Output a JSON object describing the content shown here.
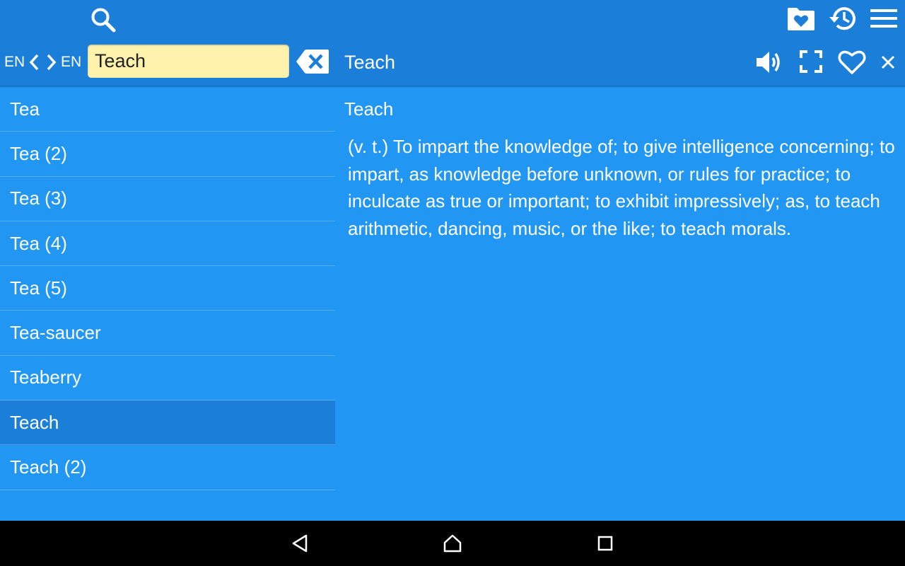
{
  "toolbar": {
    "source_lang": "EN",
    "target_lang": "EN",
    "search_value": "Teach",
    "search_placeholder": "",
    "current_word": "Teach"
  },
  "word_list": [
    {
      "label": "Tea",
      "selected": false
    },
    {
      "label": "Tea (2)",
      "selected": false
    },
    {
      "label": "Tea (3)",
      "selected": false
    },
    {
      "label": "Tea (4)",
      "selected": false
    },
    {
      "label": "Tea (5)",
      "selected": false
    },
    {
      "label": "Tea-saucer",
      "selected": false
    },
    {
      "label": "Teaberry",
      "selected": false
    },
    {
      "label": "Teach",
      "selected": true
    },
    {
      "label": "Teach (2)",
      "selected": false
    }
  ],
  "definition": {
    "title": "Teach",
    "text": "(v. t.) To impart the knowledge of; to give intelligence concerning; to impart, as knowledge before unknown, or rules for practice; to inculcate as true or important; to exhibit impressively; as, to teach arithmetic, dancing, music, or the like; to teach morals."
  },
  "colors": {
    "toolbar": "#1b7fd9",
    "background": "#2196f3",
    "selected_row": "#1b7fd9",
    "search_field": "#fff2ad",
    "navbar": "#000000"
  },
  "icons": [
    "search-icon",
    "favorites-folder-icon",
    "history-icon",
    "menu-icon",
    "chevron-left-icon",
    "chevron-right-icon",
    "clear-input-icon",
    "speaker-icon",
    "fullscreen-icon",
    "heart-icon",
    "close-icon",
    "back-nav-icon",
    "home-nav-icon",
    "recents-nav-icon"
  ]
}
